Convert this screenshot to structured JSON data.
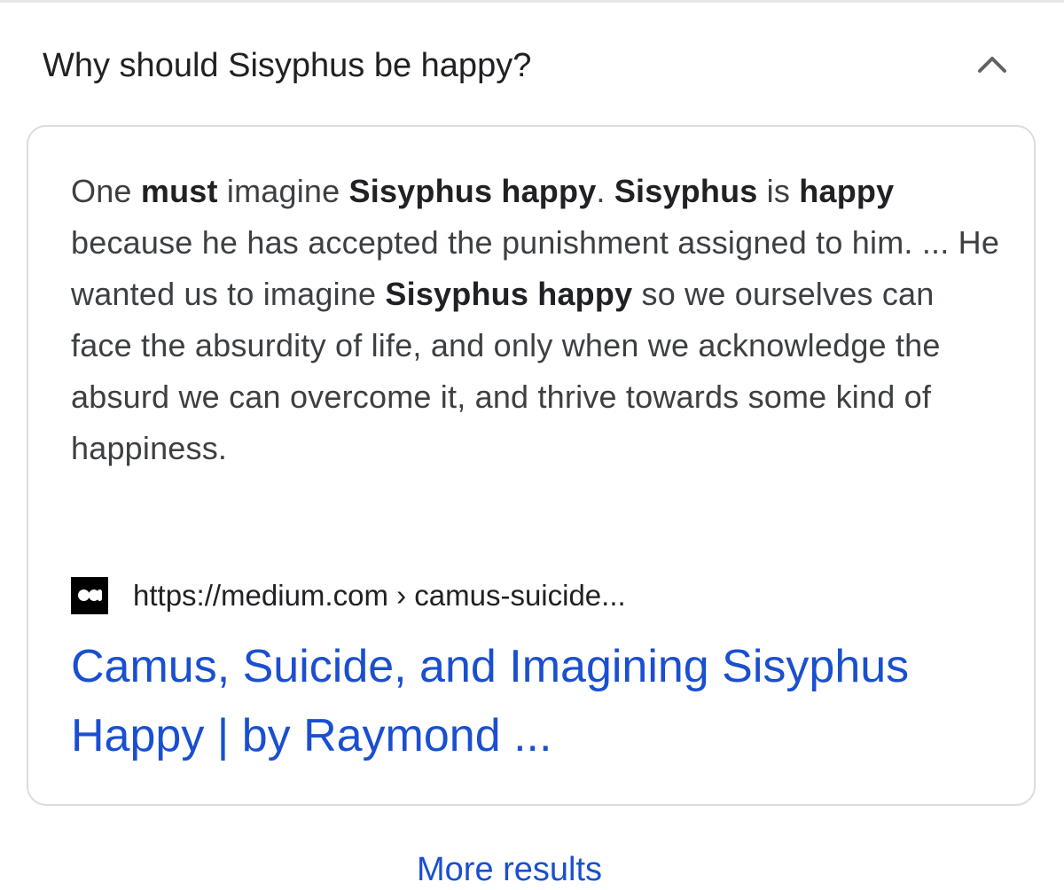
{
  "question": {
    "text": "Why should Sisyphus be happy?",
    "toggle_icon": "chevron-up-icon"
  },
  "answer": {
    "segments": [
      {
        "text": "One ",
        "bold": false
      },
      {
        "text": "must",
        "bold": true
      },
      {
        "text": " imagine ",
        "bold": false
      },
      {
        "text": "Sisyphus happy",
        "bold": true
      },
      {
        "text": ". ",
        "bold": false
      },
      {
        "text": "Sisyphus",
        "bold": true
      },
      {
        "text": " is ",
        "bold": false
      },
      {
        "text": "happy",
        "bold": true
      },
      {
        "text": " because he has accepted the punishment assigned to him. ... He wanted us to imagine ",
        "bold": false
      },
      {
        "text": "Sisyphus happy",
        "bold": true
      },
      {
        "text": " so we ourselves can face the absurdity of life, and only when we acknowledge the absurd we can overcome it, and thrive towards some kind of happiness.",
        "bold": false
      }
    ]
  },
  "source": {
    "favicon": "medium-logo-icon",
    "url": "https://medium.com › camus-suicide..."
  },
  "result": {
    "title": "Camus, Suicide, and Imagining Sisyphus Happy | by Raymond ..."
  },
  "footer": {
    "more_results": "More results"
  }
}
